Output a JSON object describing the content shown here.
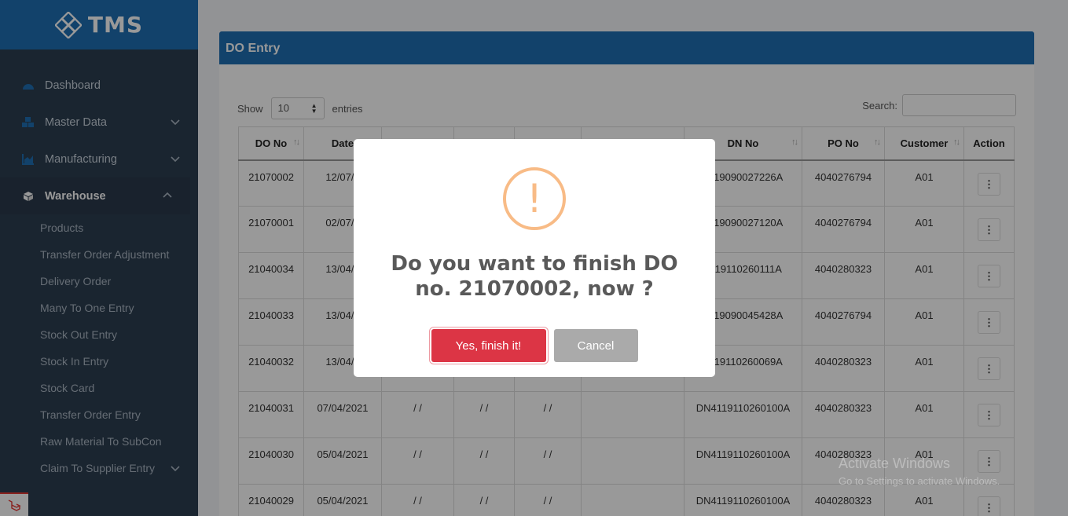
{
  "brand": {
    "name": "TMS"
  },
  "sidebar": {
    "items": [
      {
        "label": "Dashboard",
        "icon": "dashboard-icon"
      },
      {
        "label": "Master Data",
        "icon": "cubes-icon"
      },
      {
        "label": "Manufacturing",
        "icon": "chart-icon"
      },
      {
        "label": "Warehouse",
        "icon": "box-icon"
      }
    ],
    "warehouse_sub": [
      "Products",
      "Transfer Order Adjustment",
      "Delivery Order",
      "Many To One Entry",
      "Stock Out Entry",
      "Stock In Entry",
      "Stock Card",
      "Transfer Order Entry",
      "Raw Material To SubCon",
      "Claim To Supplier Entry"
    ]
  },
  "card": {
    "title": "DO Entry",
    "show_label": "Show",
    "entries_value": "10",
    "entries_label": "entries",
    "search_label": "Search:"
  },
  "table": {
    "headers": [
      "DO No",
      "Date",
      "",
      "",
      "",
      "",
      "DN No",
      "PO No",
      "Customer",
      "Action"
    ],
    "rows": [
      [
        "21070002",
        "12/07/2",
        "",
        "",
        "",
        "",
        "4119090027226A",
        "4040276794",
        "A01"
      ],
      [
        "21070001",
        "02/07/2",
        "",
        "",
        "",
        "",
        "4119090027120A",
        "4040276794",
        "A01"
      ],
      [
        "21040034",
        "13/04/2",
        "",
        "",
        "",
        "",
        "4119110260111A",
        "4040280323",
        "A01"
      ],
      [
        "21040033",
        "13/04/2",
        "",
        "",
        "",
        "",
        "4119090045428A",
        "4040276794",
        "A01"
      ],
      [
        "21040032",
        "13/04/2",
        "",
        "",
        "",
        "",
        "4119110260069A",
        "4040280323",
        "A01"
      ],
      [
        "21040031",
        "07/04/2021",
        "/ /",
        "/ /",
        "/ /",
        "",
        "DN4119110260100A",
        "4040280323",
        "A01"
      ],
      [
        "21040030",
        "05/04/2021",
        "/ /",
        "/ /",
        "/ /",
        "",
        "DN4119110260100A",
        "4040280323",
        "A01"
      ],
      [
        "21040029",
        "05/04/2021",
        "/ /",
        "/ /",
        "/ /",
        "",
        "DN4119110260100A",
        "4040280323",
        "A01"
      ]
    ]
  },
  "watermark": {
    "line1": "Activate Windows",
    "line2": "Go to Settings to activate Windows."
  },
  "modal": {
    "icon": "!",
    "title": "Do you want to finish DO no. 21070002, now ?",
    "confirm_label": "Yes, finish it!",
    "cancel_label": "Cancel"
  },
  "colors": {
    "brand": "#1f6fb2",
    "sidebar": "#2c3e50",
    "danger": "#dc3545",
    "warning": "#f8bb86"
  }
}
